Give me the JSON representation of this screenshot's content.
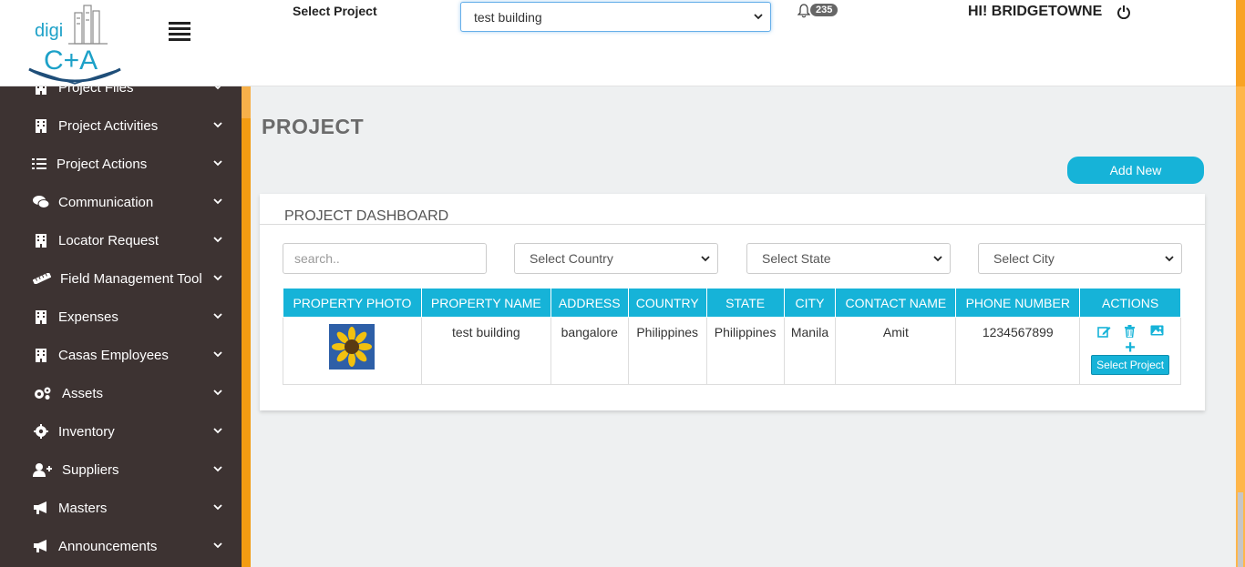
{
  "header": {
    "logo_text_top": "digi",
    "logo_text_bottom": "C+A",
    "select_label": "Select Project",
    "selected_project": "test building",
    "notifications_count": "235",
    "greeting": "HI! BRIDGETOWNE"
  },
  "sidebar": {
    "items": [
      {
        "label": "Project Files",
        "icon": "building-icon"
      },
      {
        "label": "Project Activities",
        "icon": "building-icon"
      },
      {
        "label": "Project Actions",
        "icon": "list-check-icon"
      },
      {
        "label": "Communication",
        "icon": "comments-icon"
      },
      {
        "label": "Locator Request",
        "icon": "building-icon"
      },
      {
        "label": "Field Management Tool",
        "icon": "ruler-icon"
      },
      {
        "label": "Expenses",
        "icon": "building-icon"
      },
      {
        "label": "Casas Employees",
        "icon": "building-icon"
      },
      {
        "label": "Assets",
        "icon": "cogs-icon"
      },
      {
        "label": "Inventory",
        "icon": "gear-icon"
      },
      {
        "label": "Suppliers",
        "icon": "user-plus-icon"
      },
      {
        "label": "Masters",
        "icon": "bullhorn-icon"
      },
      {
        "label": "Announcements",
        "icon": "bullhorn-icon"
      }
    ]
  },
  "main": {
    "page_title": "PROJECT",
    "add_new_label": "Add New",
    "dashboard_title": "PROJECT DASHBOARD",
    "filters": {
      "search_placeholder": "search..",
      "country": "Select Country",
      "state": "Select State",
      "city": "Select City"
    },
    "table": {
      "columns": [
        "PROPERTY PHOTO",
        "PROPERTY NAME",
        "ADDRESS",
        "COUNTRY",
        "STATE",
        "CITY",
        "CONTACT NAME",
        "PHONE NUMBER",
        "ACTIONS"
      ],
      "rows": [
        {
          "property_name": "test building",
          "address": "bangalore",
          "country": "Philippines",
          "state": "Philippines",
          "city": "Manila",
          "contact_name": "Amit",
          "phone_number": "1234567899",
          "select_button": "Select Project"
        }
      ]
    }
  },
  "colors": {
    "accent": "#16b3d8",
    "sidebar_bg": "#3d3332",
    "orange": "#f39c12"
  }
}
